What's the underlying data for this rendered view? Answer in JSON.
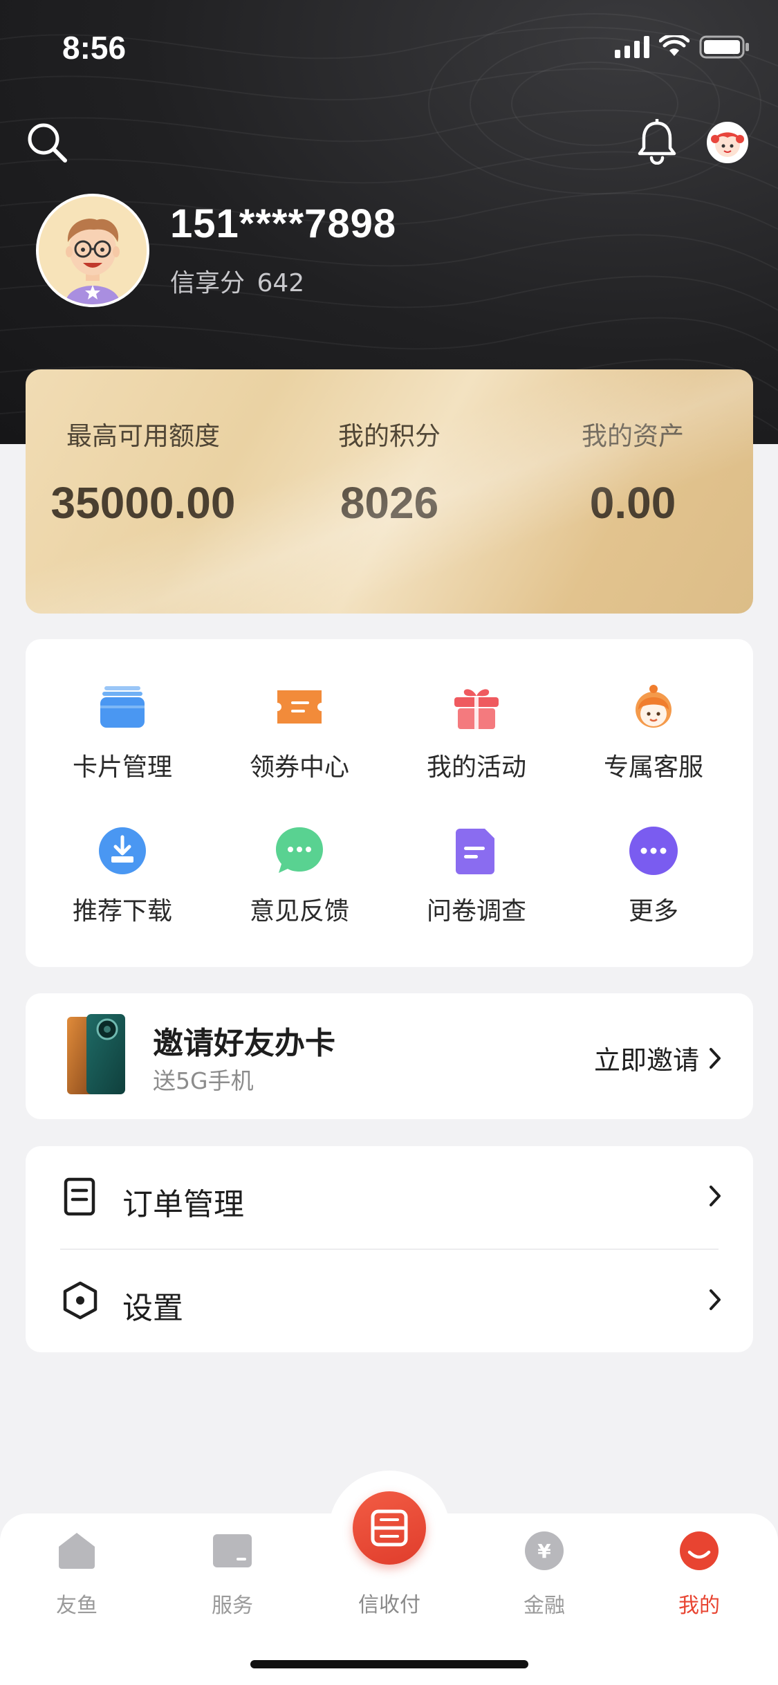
{
  "status_bar": {
    "time": "8:56"
  },
  "profile": {
    "phone": "151****7898",
    "credit_label": "信享分",
    "credit_value": "642"
  },
  "stats": [
    {
      "label": "最高可用额度",
      "value": "35000.00"
    },
    {
      "label": "我的积分",
      "value": "8026"
    },
    {
      "label": "我的资产",
      "value": "0.00"
    }
  ],
  "grid": [
    {
      "label": "卡片管理",
      "icon": "card-icon",
      "color": "#4a97f2"
    },
    {
      "label": "领券中心",
      "icon": "coupon-icon",
      "color": "#f28b3a"
    },
    {
      "label": "我的活动",
      "icon": "gift-icon",
      "color": "#ef5a5f"
    },
    {
      "label": "专属客服",
      "icon": "service-agent-icon",
      "color": "#f49a4b"
    },
    {
      "label": "推荐下载",
      "icon": "download-icon",
      "color": "#4a97f2"
    },
    {
      "label": "意见反馈",
      "icon": "chat-bubble-icon",
      "color": "#59d291"
    },
    {
      "label": "问卷调查",
      "icon": "survey-icon",
      "color": "#8a6cf0"
    },
    {
      "label": "更多",
      "icon": "more-icon",
      "color": "#7a5cf0"
    }
  ],
  "invite": {
    "title": "邀请好友办卡",
    "subtitle": "送5G手机",
    "action": "立即邀请"
  },
  "menu": [
    {
      "label": "订单管理",
      "icon": "order-list-icon"
    },
    {
      "label": "设置",
      "icon": "settings-hexagon-icon"
    }
  ],
  "tabbar": [
    {
      "label": "友鱼",
      "icon": "home-icon",
      "active": false
    },
    {
      "label": "服务",
      "icon": "service-card-icon",
      "active": false
    },
    {
      "label": "信收付",
      "icon": "scan-pay-icon",
      "active": false
    },
    {
      "label": "金融",
      "icon": "yuan-coin-icon",
      "active": false
    },
    {
      "label": "我的",
      "icon": "smile-profile-icon",
      "active": true
    }
  ],
  "colors": {
    "accent": "#e84431",
    "gold": "#e6cc9b",
    "header_dark": "#1f1f21"
  }
}
